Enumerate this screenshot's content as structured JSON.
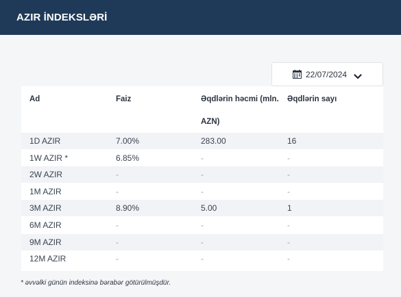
{
  "header": {
    "title": "AZIR İNDEKSLƏRİ"
  },
  "date_picker": {
    "value": "22/07/2024",
    "icon": "calendar-icon",
    "chevron": "chevron-down-icon"
  },
  "table": {
    "columns": [
      "Ad",
      "Faiz",
      "Əqdlərin həcmi (mln.",
      "AZN)",
      "Əqdlərin sayı"
    ],
    "rows": [
      {
        "name": "1D AZIR",
        "rate": "7.00%",
        "volume": "283.00",
        "count": "16"
      },
      {
        "name": "1W AZIR *",
        "rate": "6.85%",
        "volume": "-",
        "count": "-"
      },
      {
        "name": "2W AZIR",
        "rate": "-",
        "volume": "-",
        "count": "-"
      },
      {
        "name": "1M AZIR",
        "rate": "-",
        "volume": "-",
        "count": "-"
      },
      {
        "name": "3M AZIR",
        "rate": "8.90%",
        "volume": "5.00",
        "count": "1"
      },
      {
        "name": "6M AZIR",
        "rate": "-",
        "volume": "-",
        "count": "-"
      },
      {
        "name": "9M AZIR",
        "rate": "-",
        "volume": "-",
        "count": "-"
      },
      {
        "name": "12M AZIR",
        "rate": "-",
        "volume": "-",
        "count": "-"
      }
    ]
  },
  "footnote": "* əvvəlki günün indeksinə bərabər götürülmüşdür.",
  "colors": {
    "header_bg": "#1f3a58",
    "row_stripe": "#f1f3f6",
    "page_bg": "#f5f6f8"
  }
}
